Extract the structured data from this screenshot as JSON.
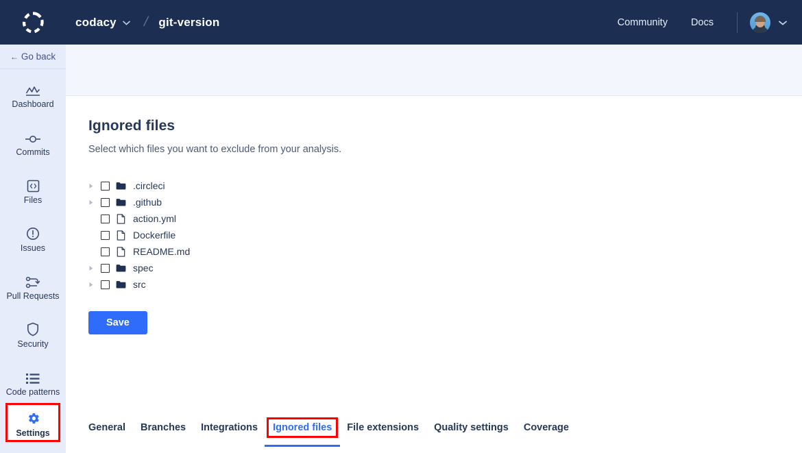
{
  "topbar": {
    "logo_icon": "codacy-dashed-circle-logo",
    "org_name": "codacy",
    "org_caret_icon": "chevron-down-icon",
    "separator": "/",
    "repo_name": "git-version",
    "community_label": "Community",
    "docs_label": "Docs",
    "avatar_icon": "user-avatar",
    "avatar_caret_icon": "chevron-down-icon",
    "background_color": "#1c2f52"
  },
  "sidebar": {
    "go_back_label": "Go back",
    "go_back_icon": "arrow-left-icon",
    "background_color": "#e7ecfb",
    "items": [
      {
        "label": "Dashboard",
        "icon": "chart-mountain-icon",
        "active": false
      },
      {
        "label": "Commits",
        "icon": "commit-node-icon",
        "active": false
      },
      {
        "label": "Files",
        "icon": "code-brackets-icon",
        "active": false
      },
      {
        "label": "Issues",
        "icon": "exclamation-circle-icon",
        "active": false
      },
      {
        "label": "Pull Requests",
        "icon": "pull-request-icon",
        "active": false
      },
      {
        "label": "Security",
        "icon": "shield-icon",
        "active": false
      },
      {
        "label": "Code patterns",
        "icon": "list-icon",
        "active": false
      },
      {
        "label": "Settings",
        "icon": "gear-icon",
        "active": true
      }
    ]
  },
  "tabs": [
    {
      "label": "General",
      "active": false
    },
    {
      "label": "Branches",
      "active": false
    },
    {
      "label": "Integrations",
      "active": false
    },
    {
      "label": "Ignored files",
      "active": true
    },
    {
      "label": "File extensions",
      "active": false
    },
    {
      "label": "Quality settings",
      "active": false
    },
    {
      "label": "Coverage",
      "active": false
    }
  ],
  "main": {
    "title": "Ignored files",
    "subtitle": "Select which files you want to exclude from your analysis.",
    "save_label": "Save",
    "accent_color": "#2f6cfc",
    "annotation_color": "#ff0000",
    "files": [
      {
        "name": ".circleci",
        "type": "folder",
        "expandable": true,
        "checked": false
      },
      {
        "name": ".github",
        "type": "folder",
        "expandable": true,
        "checked": false
      },
      {
        "name": "action.yml",
        "type": "file",
        "expandable": false,
        "checked": false
      },
      {
        "name": "Dockerfile",
        "type": "file",
        "expandable": false,
        "checked": false
      },
      {
        "name": "README.md",
        "type": "file",
        "expandable": false,
        "checked": false
      },
      {
        "name": "spec",
        "type": "folder",
        "expandable": true,
        "checked": false
      },
      {
        "name": "src",
        "type": "folder",
        "expandable": true,
        "checked": false
      }
    ]
  }
}
